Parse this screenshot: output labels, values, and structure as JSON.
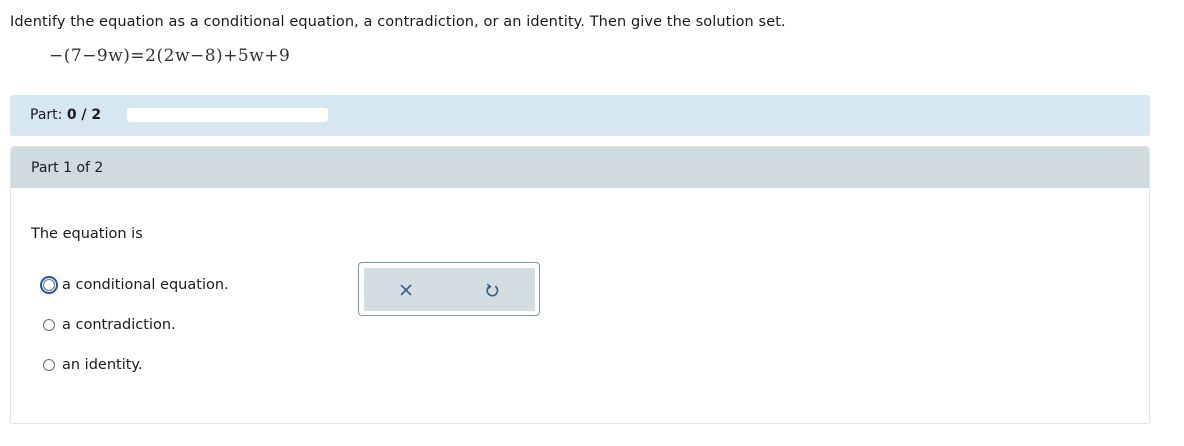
{
  "question": {
    "instructions": "Identify the equation as a conditional equation, a contradiction, or an identity. Then give the solution set.",
    "equation": "−(7−9w)=2(2w−8)+5w+9"
  },
  "progress": {
    "label": "Part:",
    "value": "0 / 2",
    "fraction": 0
  },
  "part": {
    "title": "Part 1 of 2",
    "prompt": "The equation is",
    "options": [
      {
        "label": "a conditional equation."
      },
      {
        "label": "a contradiction."
      },
      {
        "label": "an identity."
      }
    ]
  },
  "tools": {
    "clear_icon": "close-icon",
    "undo_icon": "undo-icon",
    "icon_color": "#3b5f8a"
  }
}
